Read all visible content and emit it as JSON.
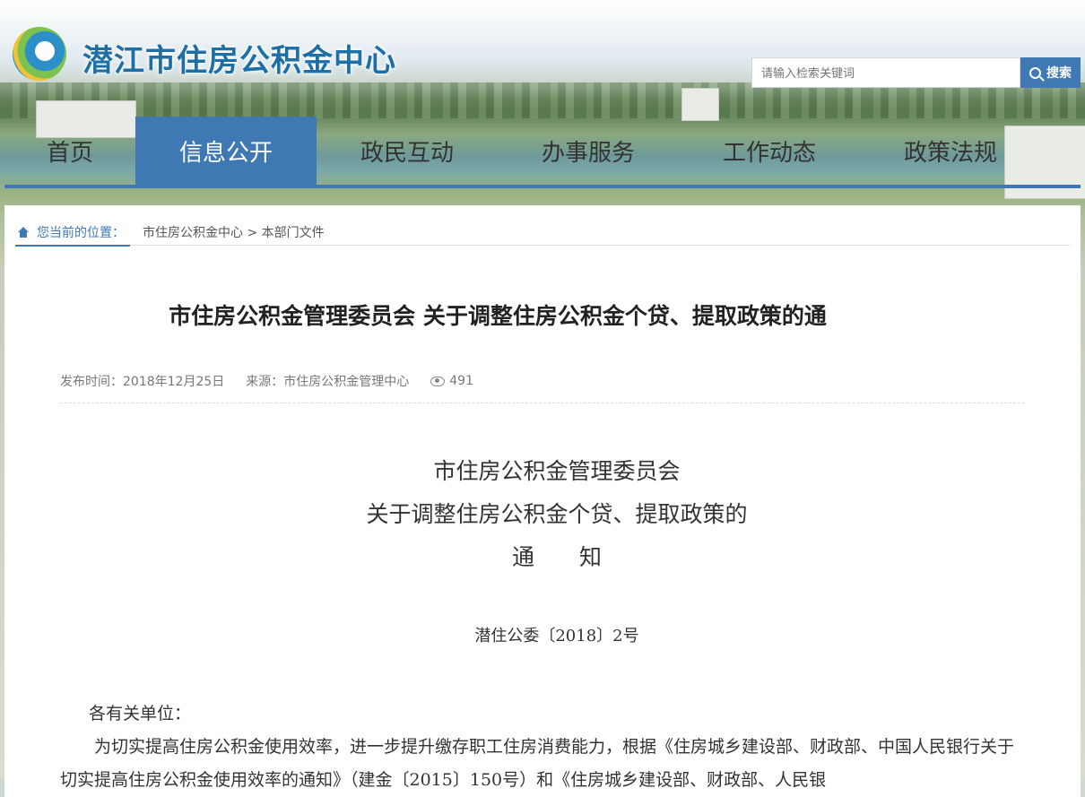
{
  "site": {
    "title": "潜江市住房公积金中心"
  },
  "search": {
    "placeholder": "请输入检索关键词",
    "button_label": "搜索"
  },
  "nav": {
    "items": [
      {
        "label": "首页"
      },
      {
        "label": "信息公开"
      },
      {
        "label": "政民互动"
      },
      {
        "label": "办事服务"
      },
      {
        "label": "工作动态"
      },
      {
        "label": "政策法规"
      }
    ],
    "active": "信息公开"
  },
  "breadcrumb": {
    "here": "您当前的位置：",
    "path": "市住房公积金中心 > 本部门文件"
  },
  "article": {
    "title": "市住房公积金管理委员会 关于调整住房公积金个贷、提取政策的通",
    "publish_time": "发布时间：2018年12月25日",
    "source": "来源：市住房公积金管理中心",
    "views": "491"
  },
  "document": {
    "heading_line1": "市住房公积金管理委员会",
    "heading_line2": "关于调整住房公积金个贷、提取政策的",
    "heading_line3": "通　　知",
    "doc_number": "潜住公委〔2018〕2号",
    "salutation": "各有关单位：",
    "paragraph1": "为切实提高住房公积金使用效率，进一步提升缴存职工住房消费能力，根据《住房城乡建设部、财政部、中国人民银行关于切实提高住房公积金使用效率的通知》（建金〔2015〕150号）和《住房城乡建设部、财政部、人民银"
  },
  "colors": {
    "accent": "#3f78b3",
    "title_blue": "#1d6fa5"
  }
}
